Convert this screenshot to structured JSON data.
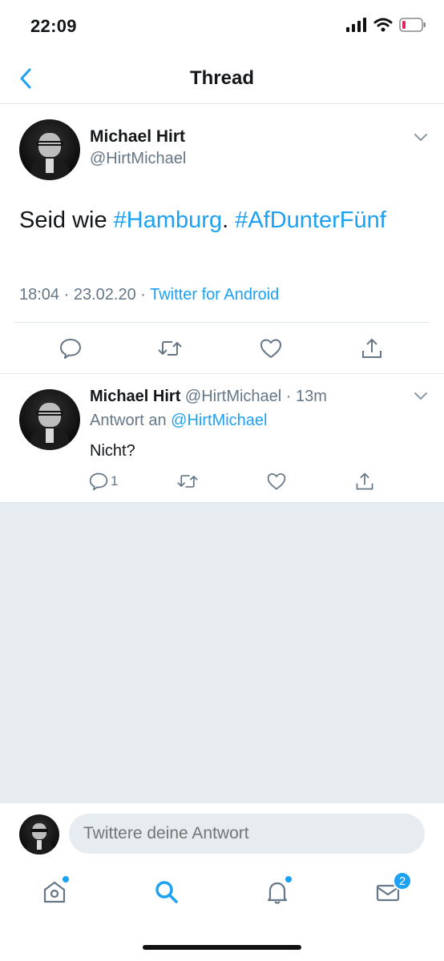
{
  "status_bar": {
    "time": "22:09",
    "icons": [
      "signal-icon",
      "wifi-icon",
      "battery-low-icon"
    ]
  },
  "nav": {
    "title": "Thread",
    "back_icon": "chevron-left-icon"
  },
  "main_tweet": {
    "name": "Michael Hirt",
    "handle": "@HirtMichael",
    "text_plain": "Seid wie ",
    "hashtag1": "#Hamburg",
    "text_mid": ". ",
    "hashtag2": "#AfDunterFünf",
    "time": "18:04",
    "dot1": " · ",
    "date": "23.02.20",
    "dot2": " · ",
    "source": "Twitter for Android",
    "actions": [
      "reply-icon",
      "retweet-icon",
      "like-icon",
      "share-icon"
    ]
  },
  "reply_tweet": {
    "name": "Michael Hirt",
    "handle": "@HirtMichael",
    "sep": " · ",
    "time": "13m",
    "reply_to_label": "Antwort an ",
    "reply_to_mention": "@HirtMichael",
    "text": "Nicht?",
    "reply_count": "1"
  },
  "compose": {
    "placeholder": "Twittere deine Antwort"
  },
  "tab_bar": {
    "tabs": [
      "home-icon",
      "search-icon",
      "notifications-icon",
      "messages-icon"
    ],
    "messages_badge": "2"
  },
  "colors": {
    "accent": "#1da1f2",
    "secondary_text": "#657786",
    "empty_background": "#e6ecf0",
    "battery_low": "#e0245e"
  }
}
